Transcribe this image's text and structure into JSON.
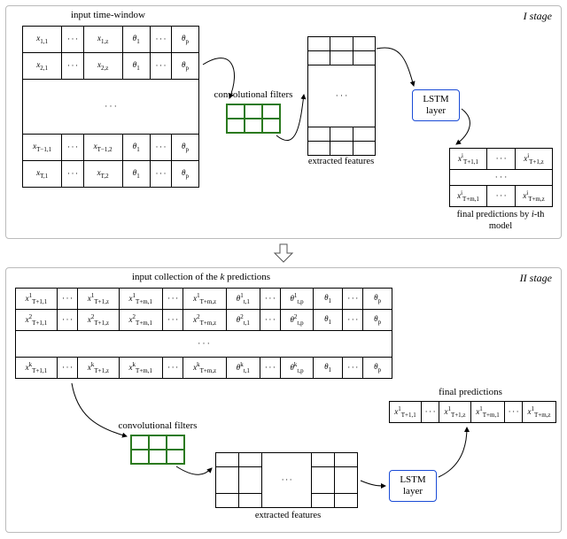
{
  "stage1": {
    "label": "I stage",
    "heading_input": "input time-window",
    "heading_conv": "convolutional filters",
    "heading_extracted": "extracted features",
    "lstm_line1": "LSTM",
    "lstm_line2": "layer",
    "heading_finalpred": "final predictions by i-th model",
    "input_matrix": {
      "r0": [
        "x_{1,1}",
        "· · ·",
        "x_{1,z}",
        "θ_{1}",
        "· · ·",
        "θ_{p}"
      ],
      "r1": [
        "x_{2,1}",
        "· · ·",
        "x_{2,z}",
        "θ_{1}",
        "· · ·",
        "θ_{p}"
      ],
      "dots": "· · ·",
      "r3": [
        "x_{T−1,1}",
        "· · ·",
        "x_{T−1,2}",
        "θ_{1}",
        "· · ·",
        "θ_{p}"
      ],
      "r4": [
        "x_{T,1}",
        "· · ·",
        "x_{T,2}",
        "θ_{1}",
        "· · ·",
        "θ_{p}"
      ]
    },
    "extracted_dots": "· · ·",
    "pred_matrix": {
      "r0": [
        "x^{i}_{T+1,1}",
        "· · ·",
        "x^{i}_{T+1,z}"
      ],
      "dots": "· · ·",
      "r2": [
        "x^{i}_{T+m,1}",
        "· · ·",
        "x^{i}_{T+m,z}"
      ]
    }
  },
  "between_arrow": "⇓",
  "stage2": {
    "label": "II stage",
    "heading_input": "input collection of the k predictions",
    "heading_conv": "convolutional filters",
    "heading_extracted": "extracted features",
    "lstm_line1": "LSTM",
    "lstm_line2": "layer",
    "heading_finalpred": "final predictions",
    "input_matrix": {
      "r0": [
        "x^{1}_{T+1,1}",
        "· · ·",
        "x^{1}_{T+1,z}",
        "x^{1}_{T+m,1}",
        "· · ·",
        "x^{1}_{T+m,z}",
        "θ^{1}_{t,1}",
        "· · ·",
        "θ^{1}_{t,p}",
        "θ_{1}",
        "· · ·",
        "θ_{p}"
      ],
      "r1": [
        "x^{2}_{T+1,1}",
        "· · ·",
        "x^{2}_{T+1,z}",
        "x^{2}_{T+m,1}",
        "· · ·",
        "x^{2}_{T+m,z}",
        "θ^{2}_{t,1}",
        "· · ·",
        "θ^{2}_{t,p}",
        "θ_{1}",
        "· · ·",
        "θ_{p}"
      ],
      "dots": "· · ·",
      "r3": [
        "x^{k}_{T+1,1}",
        "· · ·",
        "x^{k}_{T+1,z}",
        "x^{k}_{T+m,1}",
        "· · ·",
        "x^{k}_{T+m,z}",
        "θ^{k}_{t,1}",
        "· · ·",
        "θ^{k}_{t,p}",
        "θ_{1}",
        "· · ·",
        "θ_{p}"
      ]
    },
    "extracted_dots": "· · ·",
    "final_row": [
      "x^{1}_{T+1,1}",
      "· · ·",
      "x^{1}_{T+1,z}",
      "x^{1}_{T+m,1}",
      "· · ·",
      "x^{1}_{T+m,z}"
    ]
  }
}
